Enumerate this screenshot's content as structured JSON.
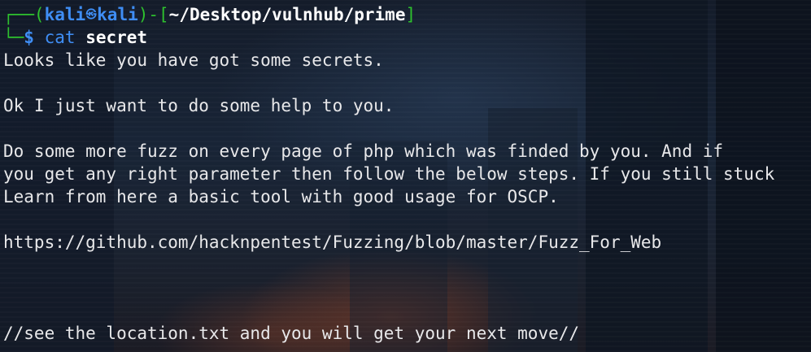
{
  "prompt": {
    "corner_top": "┌──(",
    "user": "kali",
    "host": "kali",
    "bracket_mid": ")-[",
    "path": "~/Desktop/vulnhub/prime",
    "bracket_end": "]",
    "corner_bottom": "└─",
    "dollar": "$",
    "command": "cat",
    "argument": "secret",
    "at_symbol": "㉿"
  },
  "output_lines": [
    "Looks like you have got some secrets.",
    "",
    "Ok I just want to do some help to you.",
    "",
    "Do some more fuzz on every page of php which was finded by you. And if",
    "you get any right parameter then follow the below steps. If you still stuck",
    "Learn from here a basic tool with good usage for OSCP.",
    "",
    "https://github.com/hacknpentest/Fuzzing/blob/master/Fuzz_For_Web",
    "",
    "",
    "",
    "//see the location.txt and you will get your next move//"
  ],
  "colors": {
    "prompt_green": "#2ec12e",
    "prompt_blue": "#3f8ef5",
    "text": "#e8e8ea",
    "background": "#0c1018"
  }
}
